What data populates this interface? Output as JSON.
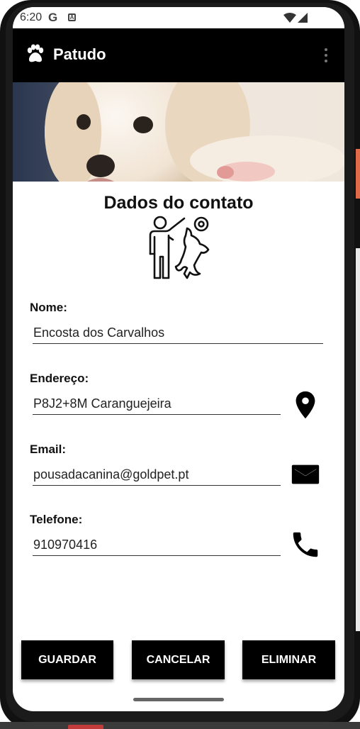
{
  "status_bar": {
    "time": "6:20",
    "g_icon": "G",
    "a_icon": "A"
  },
  "app_bar": {
    "title": "Patudo",
    "logo_icon": "paw-icon",
    "menu_icon": "more-vert-icon"
  },
  "hero": {
    "image": "puppy-photo"
  },
  "form": {
    "title": "Dados do contato",
    "fields": {
      "nome": {
        "label": "Nome:",
        "value": "Encosta dos Carvalhos"
      },
      "endereco": {
        "label": "Endereço:",
        "value": "P8J2+8M Caranguejeira",
        "icon": "location-pin-icon"
      },
      "email": {
        "label": "Email:",
        "value": "pousadacanina@goldpet.pt",
        "icon": "mail-icon"
      },
      "telefone": {
        "label": "Telefone:",
        "value": "910970416",
        "icon": "phone-icon"
      }
    }
  },
  "buttons": {
    "save": "GUARDAR",
    "cancel": "CANCELAR",
    "delete": "ELIMINAR"
  },
  "colors": {
    "app_bar": "#000000",
    "button": "#000000",
    "accent_strip": "#e06a4a"
  }
}
